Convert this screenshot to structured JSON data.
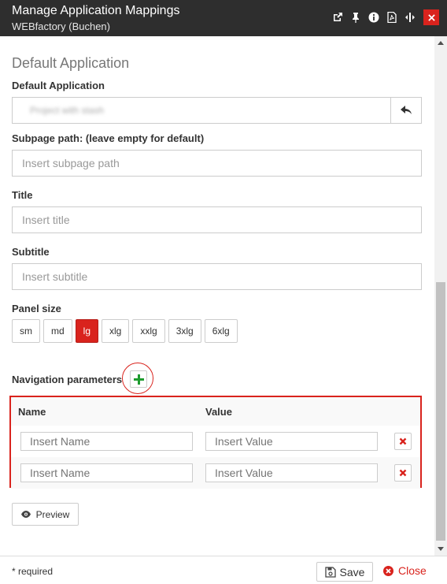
{
  "window": {
    "title": "Manage Application Mappings",
    "subtitle": "WEBfactory (Buchen)",
    "icons": [
      "external-link-icon",
      "pin-icon",
      "info-icon",
      "pdf-icon",
      "resize-icon",
      "close-icon"
    ]
  },
  "form": {
    "section_title": "Default Application",
    "default_app_label": "Default Application",
    "default_app_value": "Project with stash",
    "subpage_label": "Subpage path: (leave empty for default)",
    "subpage_placeholder": "Insert subpage path",
    "title_label": "Title",
    "title_placeholder": "Insert title",
    "subtitle_label": "Subtitle",
    "subtitle_placeholder": "Insert subtitle",
    "panel_size_label": "Panel size",
    "panel_sizes": [
      "sm",
      "md",
      "lg",
      "xlg",
      "xxlg",
      "3xlg",
      "6xlg"
    ],
    "panel_size_selected": "lg",
    "nav_params_label": "Navigation parameters",
    "params_table": {
      "columns": [
        "Name",
        "Value"
      ],
      "rows": [
        {
          "name_placeholder": "Insert Name",
          "value_placeholder": "Insert Value"
        },
        {
          "name_placeholder": "Insert Name",
          "value_placeholder": "Insert Value"
        }
      ]
    },
    "preview_label": "Preview"
  },
  "footer": {
    "required_note": "* required",
    "save_label": "Save",
    "close_label": "Close"
  },
  "colors": {
    "accent": "#d9231d",
    "titlebar": "#2e2e2e",
    "add_green": "#1e9c2f"
  }
}
